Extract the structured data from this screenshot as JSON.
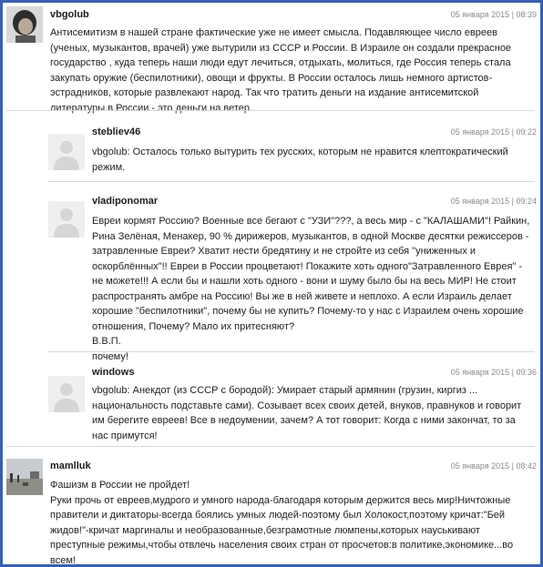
{
  "comments": [
    {
      "author": "vbgolub",
      "date": "05 января 2015 | 08:39",
      "text": "Антисемитизм в нашей стране фактические уже не имеет смысла. Подавляющее число евреев (ученых, музыкантов, врачей) уже вытурили из СССР и России. В Израиле он создали прекрасное государство , куда теперь наши люди едут лечиться, отдыхать, молиться, где Россия теперь стала закупать оружие (беспилотники), овощи и фрукты. В России осталось лишь немного артистов-эстрадников, которые развлекают народ. Так что тратить деньги на издание антисемитской литературы в России - это деньги на ветер.",
      "avatar": "user-photo"
    },
    {
      "author": "stebliev46",
      "date": "05 января 2015 | 09:22",
      "text": "vbgolub: Осталось только вытурить тех русских, которым не нравится клептократический режим.",
      "avatar": "default-user-icon"
    },
    {
      "author": "vladiponomar",
      "date": "05 января 2015 | 09:24",
      "text": "Евреи кормят Россию? Военные все бегают с \"УЗИ\"???, а весь мир - с \"КАЛАШАМИ\"! Райкин, Рина Зелёная, Менакер, 90 % дирижеров, музыкантов, в одной Москве десятки режиссеров - затравленные Евреи? Хватит нести бредятину и не стройте из себя \"униженных и оскорблённых\"!! Евреи в России процветают! Покажите хоть одного\"Затравленного Еврея\" - не можете!!! А если бы и нашли хоть одного - вони и шуму было бы на весь МИР! Не стоит распространять амбре на Россию! Вы же в ней живете и неплохо. А если Израиль делает хорошие \"беспилотники\", почему бы не купить? Почему-то у нас с Израилем очень хорошие отношения, Почему? Мало их притесняют?",
      "extra_lines": [
        "В.В.П.",
        "почему!"
      ],
      "avatar": "default-user-icon"
    },
    {
      "author": "windows",
      "date": "05 января 2015 | 09:36",
      "text": "vbgolub: Анекдот (из СССР с бородой): Умирает старый армянин (грузин, киргиз ... национальность подставьте сами). Созывает всех своих детей, внуков, правнуков и говорит им берегите евреев! Все в недоумении, зачем? А тот говорит: Когда с ними закончат, то за нас примутся!",
      "avatar": "default-user-icon"
    },
    {
      "author": "mamlluk",
      "date": "05 января 2015 | 08:42",
      "text": "Фашизм в России не пройдет!",
      "text2": "Руки прочь от евреев,мудрого и умного народа-благодаря которым держится весь мир!Ничтожные правители и диктаторы-всегда боялись умных людей-поэтому был Холокост,поэтому кричат:\"Бей жидов!\"-кричат маргиналы и необразованные,безграмотные люмпены,которых науськивают преступные режимы,чтобы отвлечь населения своих стран от просчетов:в политике,экономике...во всем!",
      "avatar": "landscape-photo"
    }
  ]
}
